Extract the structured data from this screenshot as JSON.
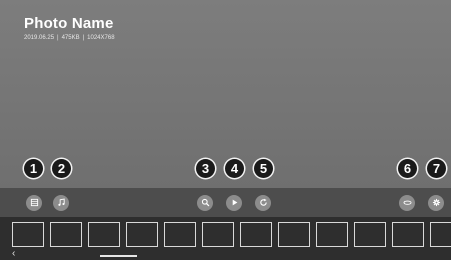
{
  "photo": {
    "title": "Photo Name",
    "date": "2019.06.25",
    "separator": "|",
    "size": "475KB",
    "resolution": "1024X768"
  },
  "callouts": [
    "1",
    "2",
    "3",
    "4",
    "5",
    "6",
    "7"
  ],
  "controls": [
    {
      "name": "list-icon"
    },
    {
      "name": "music-note-icon"
    },
    {
      "name": "zoom-icon"
    },
    {
      "name": "play-icon"
    },
    {
      "name": "rotate-icon"
    },
    {
      "name": "360-vr-icon"
    },
    {
      "name": "settings-icon"
    }
  ],
  "nav": {
    "prev": "‹"
  }
}
